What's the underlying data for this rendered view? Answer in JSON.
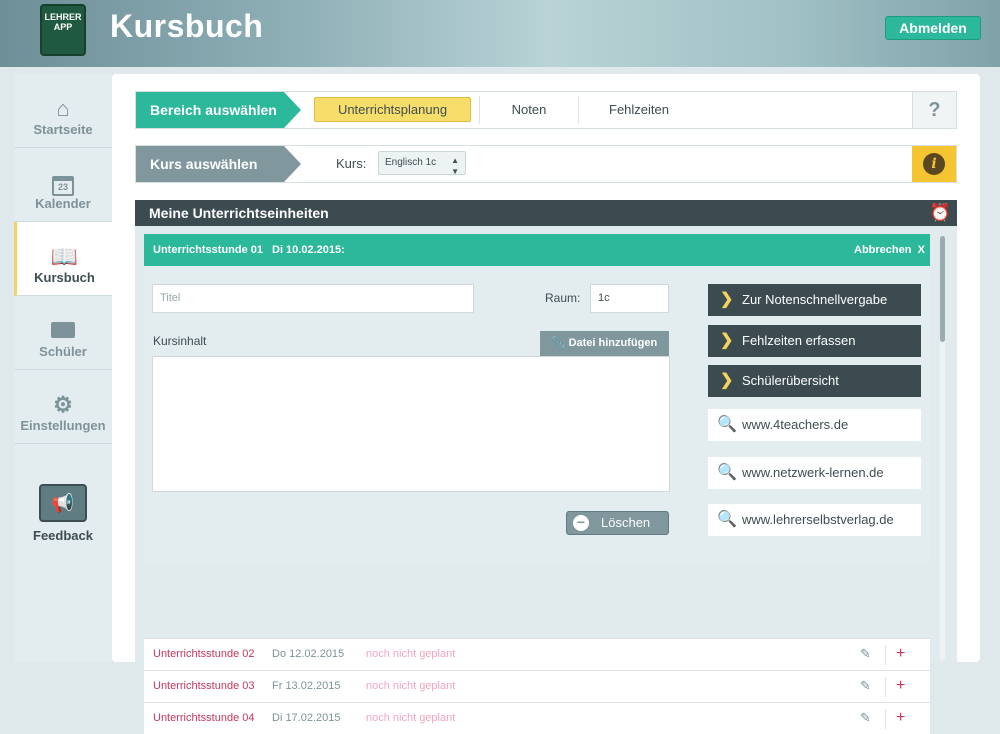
{
  "header": {
    "logo_text": "LEHRER APP",
    "title": "Kursbuch",
    "logout_label": "Abmelden"
  },
  "sidebar": {
    "items": [
      {
        "label": "Startseite",
        "icon": "home-icon"
      },
      {
        "label": "Kalender",
        "icon": "calendar-icon",
        "icon_text": "23"
      },
      {
        "label": "Kursbuch",
        "icon": "book-icon"
      },
      {
        "label": "Schüler",
        "icon": "student-card-icon"
      },
      {
        "label": "Einstellungen",
        "icon": "gear-icon"
      }
    ],
    "feedback_label": "Feedback"
  },
  "section_bar": {
    "title": "Bereich auswählen",
    "tabs": [
      "Unterrichtsplanung",
      "Noten",
      "Fehlzeiten"
    ],
    "active_tab": "Unterrichtsplanung",
    "help": "?"
  },
  "course_bar": {
    "title": "Kurs auswählen",
    "kurs_label": "Kurs:",
    "selected_course": "Englisch 1c",
    "info": "i"
  },
  "panel": {
    "title": "Meine Unterrichtseinheiten",
    "active_lesson": {
      "name": "Unterrichtsstunde 01",
      "date": "Di 10.02.2015:",
      "cancel_label": "Abbrechen",
      "cancel_x": "X",
      "title_placeholder": "Titel",
      "raum_label": "Raum:",
      "raum_value": "1c",
      "kursinhalt_label": "Kursinhalt",
      "attach_label": "Datei hinzufügen",
      "delete_label": "Löschen"
    },
    "actions": [
      "Zur Notenschnellvergabe",
      "Fehlzeiten erfassen",
      "Schülerübersicht"
    ],
    "links": [
      "www.4teachers.de",
      "www.netzwerk-lernen.de",
      "www.lehrerselbstverlag.de"
    ],
    "lessons": [
      {
        "name": "Unterrichtsstunde 02",
        "date": "Do 12.02.2015",
        "status": "noch nicht geplant"
      },
      {
        "name": "Unterrichtsstunde 03",
        "date": "Fr 13.02.2015",
        "status": "noch nicht geplant"
      },
      {
        "name": "Unterrichtsstunde 04",
        "date": "Di 17.02.2015",
        "status": "noch nicht geplant"
      }
    ]
  },
  "colors": {
    "accent_green": "#2cb89a",
    "highlight_yellow": "#f7de6b",
    "dark_slate": "#3b4b50",
    "lesson_red": "#c0395a"
  }
}
